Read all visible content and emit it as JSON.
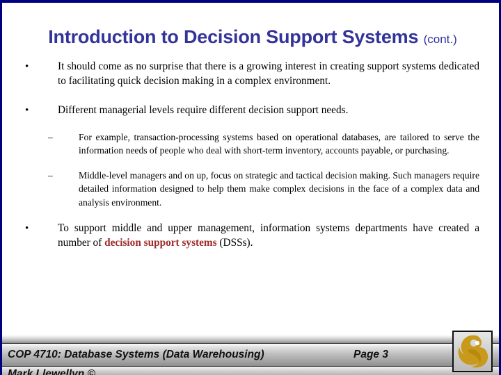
{
  "slide": {
    "title_main": "Introduction to Decision Support Systems",
    "title_cont": "(cont.)",
    "title_color": "#333399"
  },
  "content": {
    "bullet_marker": "•",
    "sub_marker": "–",
    "bullets": [
      {
        "marker": "•",
        "text": "It should come as no surprise that there is a growing interest in creating support systems dedicated to facilitating quick decision making in a complex environment."
      },
      {
        "marker": "•",
        "text": "Different managerial levels require different decision support needs."
      }
    ],
    "subbullets": [
      {
        "marker": "–",
        "text": "For example, transaction-processing systems based on operational databases, are tailored to serve the information needs of people who deal with short-term inventory, accounts payable, or purchasing."
      },
      {
        "marker": "–",
        "text": "Middle-level managers and on up, focus on strategic and tactical decision making.  Such managers require detailed information designed to help them make complex decisions in the face of a complex data and analysis environment."
      }
    ],
    "final_bullet": {
      "marker": "•",
      "text_before": "To support middle and upper management, information systems departments have created a number of ",
      "highlight": "decision support systems",
      "highlight_color": "#9e2b2b",
      "text_after": " (DSSs)."
    }
  },
  "footer": {
    "course": "COP 4710: Database Systems  (Data Warehousing)",
    "page": "Page 3",
    "author": "Mark Llewellyn ©",
    "logo_name": "ucf-pegasus-logo",
    "logo_color": "#c8991a"
  }
}
